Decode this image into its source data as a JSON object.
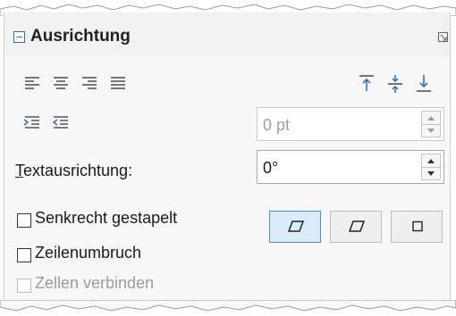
{
  "panel": {
    "title": "Ausrichtung"
  },
  "indent": {
    "value": "0 pt"
  },
  "text_orientation": {
    "label_mnemonic": "T",
    "label_rest": "extausrichtung:",
    "value": "0°"
  },
  "checkboxes": {
    "vertically_stacked": "Senkrecht gestapelt",
    "wrap_text": "Zeilenumbruch",
    "merge_cells": "Zellen verbinden"
  },
  "icons": {
    "collapse": "collapse-minus-icon",
    "more_options": "more-options-icon",
    "align_left": "align-left-icon",
    "align_center": "align-center-icon",
    "align_right": "align-right-icon",
    "align_justify": "align-justify-icon",
    "align_top": "align-top-icon",
    "align_middle": "align-middle-icon",
    "align_bottom": "align-bottom-icon",
    "increase_indent": "increase-indent-icon",
    "decrease_indent": "decrease-indent-icon"
  },
  "colors": {
    "accent_blue": "#2f6fb8",
    "active_toggle_bg": "#dcebfb"
  }
}
